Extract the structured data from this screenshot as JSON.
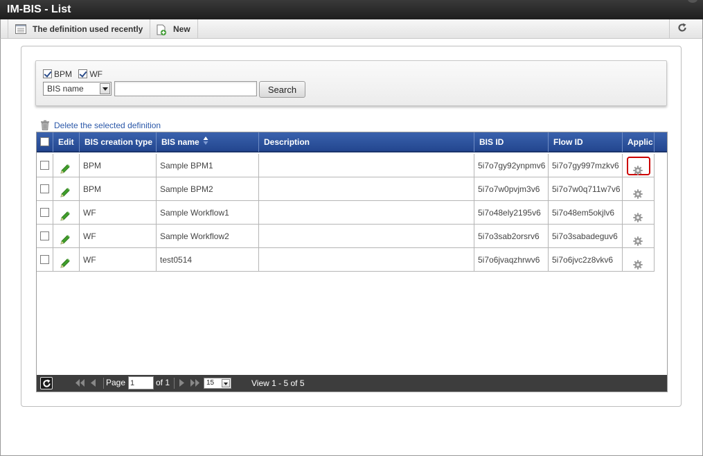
{
  "window": {
    "title": "IM-BIS - List"
  },
  "toolbar": {
    "recent_label": "The definition used recently",
    "new_label": "New"
  },
  "filters": {
    "bpm_label": "BPM",
    "bpm_checked": true,
    "wf_label": "WF",
    "wf_checked": true,
    "field_select_value": "BIS name",
    "search_value": "",
    "search_button": "Search"
  },
  "actions": {
    "delete_selected": "Delete the selected definition"
  },
  "grid": {
    "columns": {
      "edit": "Edit",
      "creation_type": "BIS creation type",
      "bis_name": "BIS name",
      "description": "Description",
      "bis_id": "BIS ID",
      "flow_id": "Flow ID",
      "applic": "Applic"
    },
    "sort_column": "BIS name",
    "sort_direction": "ascending",
    "rows": [
      {
        "type": "BPM",
        "name": "Sample BPM1",
        "description": "",
        "bis_id": "5i7o7gy92ynpmv6",
        "flow_id": "5i7o7gy997mzkv6"
      },
      {
        "type": "BPM",
        "name": "Sample BPM2",
        "description": "",
        "bis_id": "5i7o7w0pvjm3v6",
        "flow_id": "5i7o7w0q711w7v6"
      },
      {
        "type": "WF",
        "name": "Sample Workflow1",
        "description": "",
        "bis_id": "5i7o48ely2195v6",
        "flow_id": "5i7o48em5okjlv6"
      },
      {
        "type": "WF",
        "name": "Sample Workflow2",
        "description": "",
        "bis_id": "5i7o3sab2orsrv6",
        "flow_id": "5i7o3sabadeguv6"
      },
      {
        "type": "WF",
        "name": "test0514",
        "description": "",
        "bis_id": "5i7o6jvaqzhrwv6",
        "flow_id": "5i7o6jvc2z8vkv6"
      }
    ]
  },
  "pager": {
    "page_label": "Page",
    "page_value": "1",
    "of_label": "of 1",
    "page_size": "15",
    "view_text": "View 1 - 5 of 5"
  },
  "colors": {
    "header_blue": "#2b4c97",
    "pager_dark": "#3d3d3d",
    "highlight_red": "#cc0000",
    "link_blue": "#2a57a8"
  },
  "icons": [
    "list-icon",
    "new-doc-icon",
    "refresh-icon",
    "trash-icon",
    "pencil-icon",
    "gear-icon",
    "sort-asc-icon",
    "first-page-icon",
    "prev-page-icon",
    "next-page-icon",
    "last-page-icon"
  ]
}
